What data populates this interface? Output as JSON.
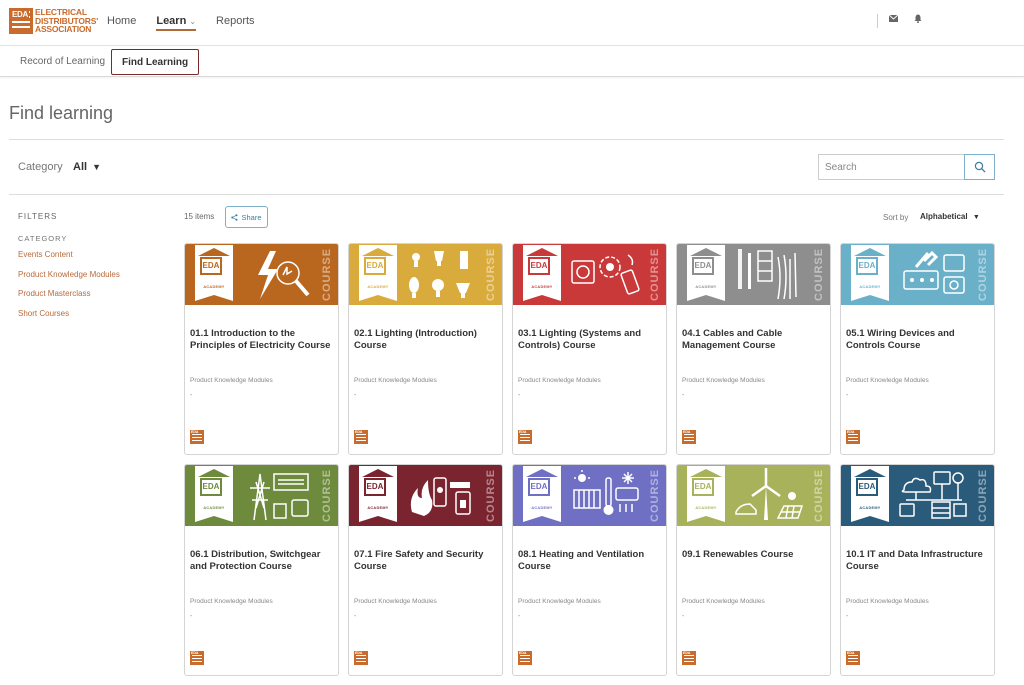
{
  "logo": {
    "mark": "EDA",
    "lines": [
      "ELECTRICAL",
      "DISTRIBUTORS'",
      "ASSOCIATION"
    ]
  },
  "nav": {
    "home": "Home",
    "learn": "Learn",
    "reports": "Reports"
  },
  "icons": {
    "mail": "envelope-icon",
    "bell": "bell-icon"
  },
  "subtabs": {
    "record": "Record of Learning",
    "find": "Find Learning"
  },
  "page": {
    "title": "Find learning"
  },
  "category": {
    "label": "Category",
    "value": "All"
  },
  "search": {
    "placeholder": "Search"
  },
  "filters": {
    "title": "FILTERS",
    "category_heading": "CATEGORY",
    "items": [
      "Events Content",
      "Product Knowledge Modules",
      "Product Masterclass",
      "Short Courses"
    ]
  },
  "results": {
    "count": "15 items",
    "share": "Share",
    "sort_label": "Sort by",
    "sort_value": "Alphabetical"
  },
  "card_common": {
    "badge_text": "EDA",
    "academy": "ACADEMY",
    "course": "COURSE"
  },
  "cards": [
    {
      "title": "01.1 Introduction to the Principles of Electricity Course",
      "type": "Product Knowledge Modules",
      "extra": "-",
      "color": "#b9661f",
      "icon": "lightning-magnifier-icon"
    },
    {
      "title": "02.1 Lighting (Introduction) Course",
      "type": "Product Knowledge Modules",
      "extra": "-",
      "color": "#d9aa3c",
      "icon": "light-bulbs-icon"
    },
    {
      "title": "03.1 Lighting (Systems and Controls) Course",
      "type": "Product Knowledge Modules",
      "extra": "-",
      "color": "#c9393a",
      "icon": "controls-gear-icon"
    },
    {
      "title": "04.1 Cables and Cable Management Course",
      "type": "Product Knowledge Modules",
      "extra": "-",
      "color": "#8e8e8e",
      "icon": "cables-icon"
    },
    {
      "title": "05.1 Wiring Devices and Controls Course",
      "type": "Product Knowledge Modules",
      "extra": "-",
      "color": "#6bb0c9",
      "icon": "plug-socket-icon"
    },
    {
      "title": "06.1 Distribution, Switchgear and Protection Course",
      "type": "Product Knowledge Modules",
      "extra": "-",
      "color": "#6e8a3c",
      "icon": "pylon-switchgear-icon"
    },
    {
      "title": "07.1 Fire Safety and Security Course",
      "type": "Product Knowledge Modules",
      "extra": "-",
      "color": "#7a2430",
      "icon": "fire-lock-icon"
    },
    {
      "title": "08.1 Heating and Ventilation Course",
      "type": "Product Knowledge Modules",
      "extra": "-",
      "color": "#6f6fc4",
      "icon": "radiator-thermometer-icon"
    },
    {
      "title": "09.1 Renewables Course",
      "type": "Product Knowledge Modules",
      "extra": "-",
      "color": "#a7b25b",
      "icon": "wind-turbine-solar-icon"
    },
    {
      "title": "10.1 IT and Data Infrastructure Course",
      "type": "Product Knowledge Modules",
      "extra": "-",
      "color": "#2b5b7a",
      "icon": "network-cloud-icon"
    }
  ]
}
